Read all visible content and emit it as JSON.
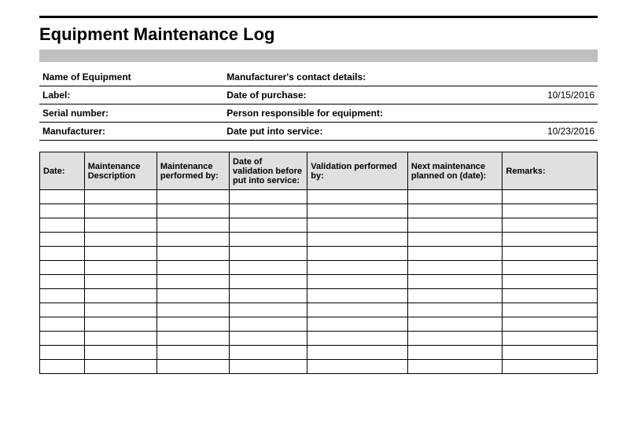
{
  "title": "Equipment Maintenance Log",
  "info": {
    "rows": [
      {
        "left_label": "Name of Equipment",
        "left_value": "",
        "right_label": "Manufacturer's contact details:",
        "right_value": ""
      },
      {
        "left_label": "Label:",
        "left_value": "",
        "right_label": "Date of purchase:",
        "right_value": "10/15/2016"
      },
      {
        "left_label": "Serial number:",
        "left_value": "",
        "right_label": "Person responsible for equipment:",
        "right_value": ""
      },
      {
        "left_label": "Manufacturer:",
        "left_value": "",
        "right_label": "Date put into service:",
        "right_value": "10/23/2016"
      }
    ]
  },
  "log": {
    "headers": [
      "Date:",
      "Maintenance Description",
      "Maintenance performed by:",
      "Date of validation before put into service:",
      "Validation performed by:",
      "Next maintenance planned on (date):",
      "Remarks:"
    ],
    "rows": [
      [
        "",
        "",
        "",
        "",
        "",
        "",
        ""
      ],
      [
        "",
        "",
        "",
        "",
        "",
        "",
        ""
      ],
      [
        "",
        "",
        "",
        "",
        "",
        "",
        ""
      ],
      [
        "",
        "",
        "",
        "",
        "",
        "",
        ""
      ],
      [
        "",
        "",
        "",
        "",
        "",
        "",
        ""
      ],
      [
        "",
        "",
        "",
        "",
        "",
        "",
        ""
      ],
      [
        "",
        "",
        "",
        "",
        "",
        "",
        ""
      ],
      [
        "",
        "",
        "",
        "",
        "",
        "",
        ""
      ],
      [
        "",
        "",
        "",
        "",
        "",
        "",
        ""
      ],
      [
        "",
        "",
        "",
        "",
        "",
        "",
        ""
      ],
      [
        "",
        "",
        "",
        "",
        "",
        "",
        ""
      ],
      [
        "",
        "",
        "",
        "",
        "",
        "",
        ""
      ],
      [
        "",
        "",
        "",
        "",
        "",
        "",
        ""
      ]
    ]
  }
}
